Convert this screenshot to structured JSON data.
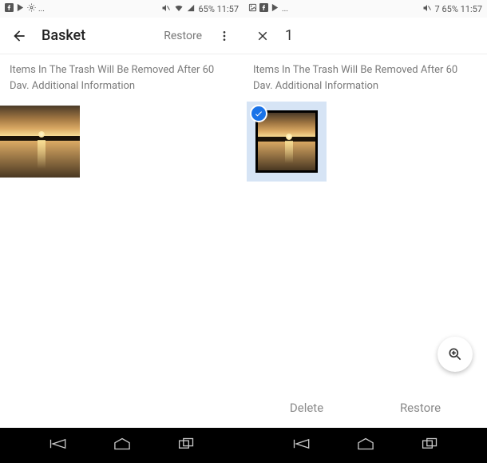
{
  "left": {
    "status": {
      "left_icons": [
        "facebook-icon",
        "play-icon",
        "settings-icon",
        "more"
      ],
      "right_text": "65% 11:57",
      "right_icons": [
        "mute-icon",
        "wifi-icon",
        "signal-icon",
        "battery-icon"
      ]
    },
    "appbar": {
      "title": "Basket",
      "action": "Restore"
    },
    "notice_line1": "Items In The Trash Will Be Removed After 60",
    "notice_line2": "Dav. Additional Information"
  },
  "right": {
    "status": {
      "left_icons": [
        "image-icon",
        "facebook-icon",
        "play-icon",
        "more"
      ],
      "right_text": "7 65% 11:57",
      "right_icons": [
        "mute-icon"
      ]
    },
    "appbar": {
      "count": "1"
    },
    "notice_line1": "Items In The Trash Will Be Removed After 60",
    "notice_line2": "Dav. Additional Information",
    "actions": {
      "delete": "Delete",
      "restore": "Restore"
    }
  }
}
